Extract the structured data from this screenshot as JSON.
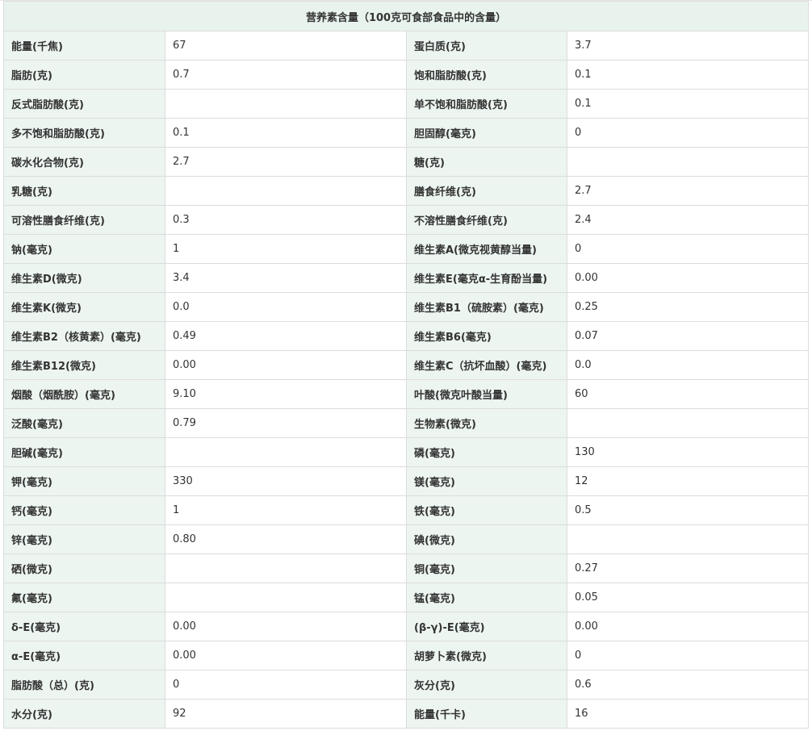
{
  "table": {
    "title": "营养素含量（100克可食部食品中的含量）",
    "rows": [
      [
        {
          "label": "能量(千焦)",
          "value": "67"
        },
        {
          "label": "蛋白质(克)",
          "value": "3.7"
        }
      ],
      [
        {
          "label": "脂肪(克)",
          "value": "0.7"
        },
        {
          "label": "饱和脂肪酸(克)",
          "value": "0.1"
        }
      ],
      [
        {
          "label": "反式脂肪酸(克)",
          "value": ""
        },
        {
          "label": "单不饱和脂肪酸(克)",
          "value": "0.1"
        }
      ],
      [
        {
          "label": "多不饱和脂肪酸(克)",
          "value": "0.1"
        },
        {
          "label": "胆固醇(毫克)",
          "value": "0"
        }
      ],
      [
        {
          "label": "碳水化合物(克)",
          "value": "2.7"
        },
        {
          "label": "糖(克)",
          "value": ""
        }
      ],
      [
        {
          "label": "乳糖(克)",
          "value": ""
        },
        {
          "label": "膳食纤维(克)",
          "value": "2.7"
        }
      ],
      [
        {
          "label": "可溶性膳食纤维(克)",
          "value": "0.3"
        },
        {
          "label": "不溶性膳食纤维(克)",
          "value": "2.4"
        }
      ],
      [
        {
          "label": "钠(毫克)",
          "value": "1"
        },
        {
          "label": "维生素A(微克视黄醇当量)",
          "value": "0"
        }
      ],
      [
        {
          "label": "维生素D(微克)",
          "value": "3.4"
        },
        {
          "label": "维生素E(毫克α-生育酚当量)",
          "value": "0.00"
        }
      ],
      [
        {
          "label": "维生素K(微克)",
          "value": "0.0"
        },
        {
          "label": "维生素B1（硫胺素）(毫克)",
          "value": "0.25"
        }
      ],
      [
        {
          "label": "维生素B2（核黄素）(毫克)",
          "value": "0.49"
        },
        {
          "label": "维生素B6(毫克)",
          "value": "0.07"
        }
      ],
      [
        {
          "label": "维生素B12(微克)",
          "value": "0.00"
        },
        {
          "label": "维生素C（抗坏血酸）(毫克)",
          "value": "0.0"
        }
      ],
      [
        {
          "label": "烟酸（烟酰胺）(毫克)",
          "value": "9.10"
        },
        {
          "label": "叶酸(微克叶酸当量)",
          "value": "60"
        }
      ],
      [
        {
          "label": "泛酸(毫克)",
          "value": "0.79"
        },
        {
          "label": "生物素(微克)",
          "value": ""
        }
      ],
      [
        {
          "label": "胆碱(毫克)",
          "value": ""
        },
        {
          "label": "磷(毫克)",
          "value": "130"
        }
      ],
      [
        {
          "label": "钾(毫克)",
          "value": "330"
        },
        {
          "label": "镁(毫克)",
          "value": "12"
        }
      ],
      [
        {
          "label": "钙(毫克)",
          "value": "1"
        },
        {
          "label": "铁(毫克)",
          "value": "0.5"
        }
      ],
      [
        {
          "label": "锌(毫克)",
          "value": "0.80"
        },
        {
          "label": "碘(微克)",
          "value": ""
        }
      ],
      [
        {
          "label": "硒(微克)",
          "value": ""
        },
        {
          "label": "铜(毫克)",
          "value": "0.27"
        }
      ],
      [
        {
          "label": "氟(毫克)",
          "value": ""
        },
        {
          "label": "锰(毫克)",
          "value": "0.05"
        }
      ],
      [
        {
          "label": "δ-E(毫克)",
          "value": "0.00"
        },
        {
          "label": "(β-γ)-E(毫克)",
          "value": "0.00"
        }
      ],
      [
        {
          "label": "α-E(毫克)",
          "value": "0.00"
        },
        {
          "label": "胡萝卜素(微克)",
          "value": "0"
        }
      ],
      [
        {
          "label": "脂肪酸（总）(克)",
          "value": "0"
        },
        {
          "label": "灰分(克)",
          "value": "0.6"
        }
      ],
      [
        {
          "label": "水分(克)",
          "value": "92"
        },
        {
          "label": "能量(千卡)",
          "value": "16"
        }
      ]
    ]
  }
}
